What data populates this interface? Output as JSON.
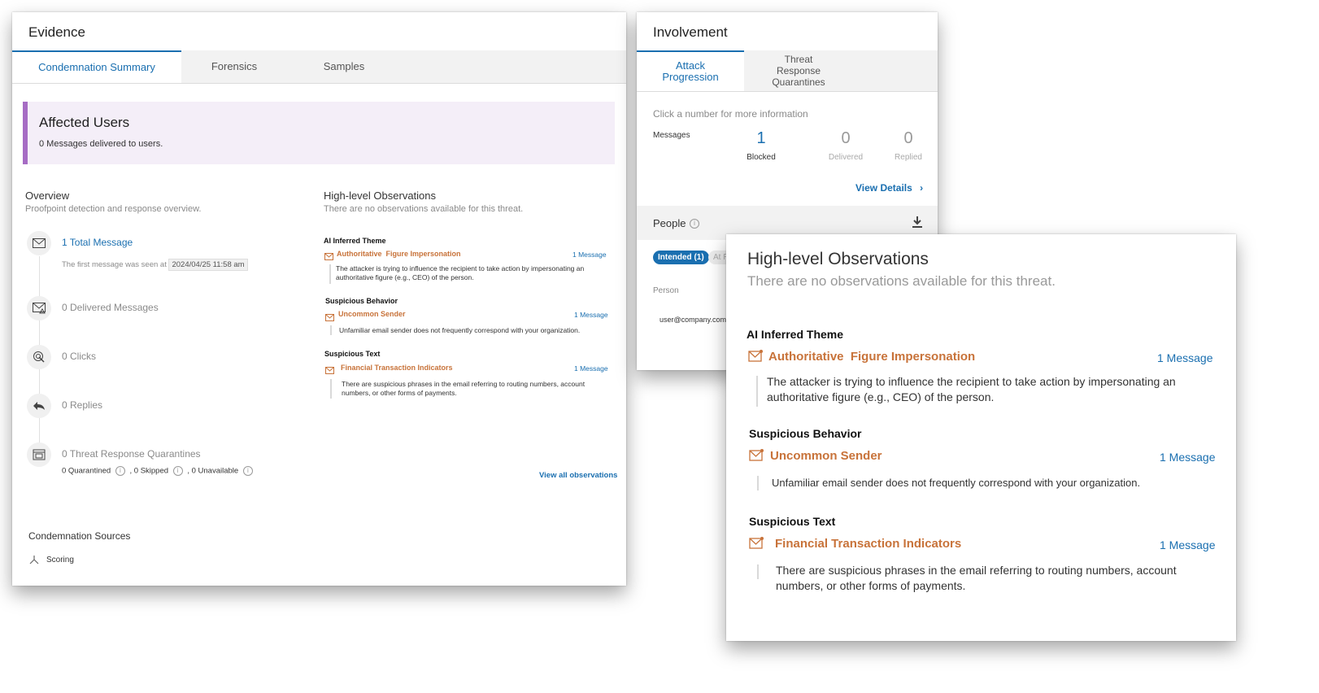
{
  "evidence": {
    "title": "Evidence",
    "tabs": [
      "Condemnation Summary",
      "Forensics",
      "Samples"
    ],
    "affected": {
      "title": "Affected Users",
      "subtitle": "0 Messages delivered to users."
    },
    "overview": {
      "title": "Overview",
      "subtitle": "Proofpoint detection and response overview."
    },
    "timeline": {
      "total": "1 Total Message",
      "first_seen_prefix": "The first message was seen at",
      "first_seen_date": "2024/04/25 11:58 am",
      "delivered": "0 Delivered Messages",
      "clicks": "0 Clicks",
      "replies": "0 Replies",
      "quarantines": "0 Threat Response Quarantines",
      "quarantined": "0 Quarantined",
      "skipped": ", 0 Skipped",
      "unavailable": ", 0 Unavailable"
    },
    "observations": {
      "title": "High-level Observations",
      "subtitle": "There are no observations available for this threat.",
      "items": [
        {
          "category": "AI Inferred Theme",
          "name": "Authoritative  Figure Impersonation",
          "count": "1 Message",
          "description": "The attacker is trying to influence the recipient to take action by impersonating an authoritative figure (e.g., CEO) of the person."
        },
        {
          "category": "Suspicious Behavior",
          "name": "Uncommon Sender",
          "count": "1 Message",
          "description": "Unfamiliar email sender does not frequently correspond with your organization."
        },
        {
          "category": "Suspicious Text",
          "name": "Financial Transaction Indicators",
          "count": "1 Message",
          "description": "There are suspicious phrases in the email referring to routing numbers, account numbers, or other forms of payments."
        }
      ],
      "view_all": "View all observations"
    },
    "sources": {
      "title": "Condemnation Sources",
      "item": "Scoring"
    }
  },
  "involvement": {
    "title": "Involvement",
    "tabs": [
      "Attack Progression",
      "Threat Response Quarantines"
    ],
    "hint": "Click a number for more information",
    "messages_label": "Messages",
    "stats": [
      {
        "value": "1",
        "label": "Blocked"
      },
      {
        "value": "0",
        "label": "Delivered"
      },
      {
        "value": "0",
        "label": "Replied"
      }
    ],
    "view_details": "View Details",
    "people": "People",
    "chips": [
      "Intended (1)",
      "At R"
    ],
    "person_header": "Person",
    "person": "user@company.com"
  },
  "colors": {
    "accent": "#1a6fb0",
    "orange": "#c8733a",
    "affected_bg": "#f4eef8",
    "affected_bar": "#a66cc4"
  }
}
